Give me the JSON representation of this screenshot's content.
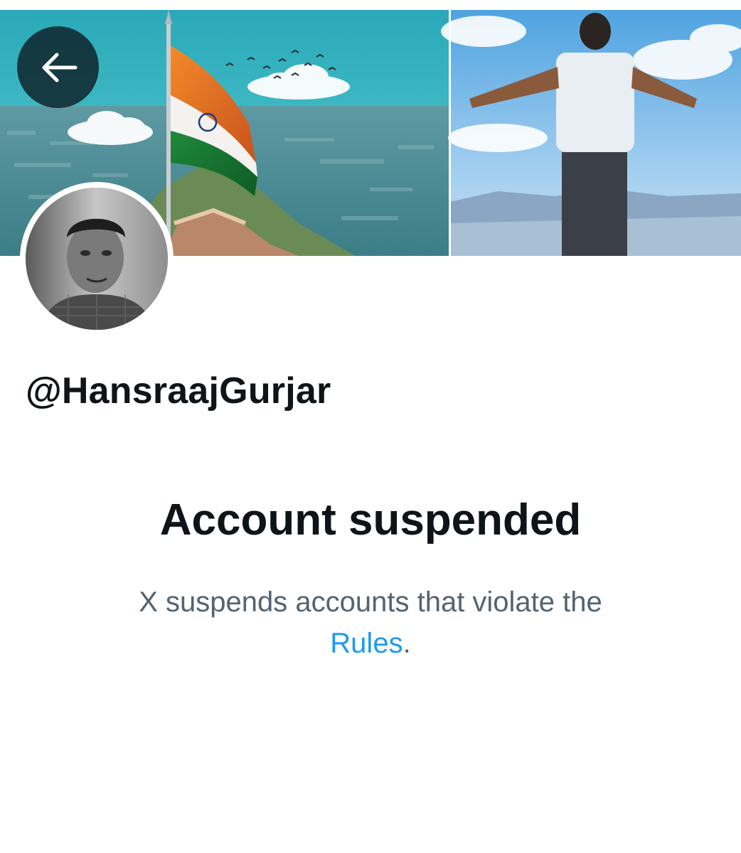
{
  "profile": {
    "handle": "@HansraajGurjar"
  },
  "header": {
    "back_icon": "arrow-left-icon"
  },
  "suspension": {
    "title": "Account suspended",
    "description_prefix": "X suspends accounts that violate the",
    "rules_link": "Rules",
    "description_suffix": "."
  },
  "colors": {
    "text_primary": "#0f1419",
    "text_secondary": "#536471",
    "link": "#1d9bf0",
    "back_button_bg": "#0f1e26"
  }
}
